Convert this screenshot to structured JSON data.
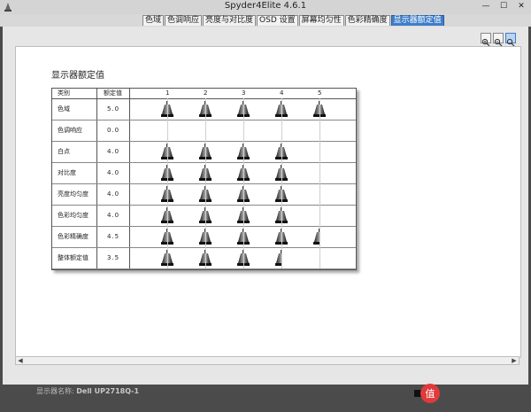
{
  "window": {
    "title": "Spyder4Elite 4.6.1"
  },
  "tabs": [
    {
      "label": "色域",
      "active": false
    },
    {
      "label": "色调响应",
      "active": false
    },
    {
      "label": "亮度与对比度",
      "active": false
    },
    {
      "label": "OSD 设置",
      "active": false
    },
    {
      "label": "屏幕均匀性",
      "active": false
    },
    {
      "label": "色彩精确度",
      "active": false
    },
    {
      "label": "显示器额定值",
      "active": true
    }
  ],
  "report": {
    "title": "显示器额定值",
    "headers": {
      "category": "类别",
      "rating": "额定值",
      "scale": [
        "1",
        "2",
        "3",
        "4",
        "5"
      ]
    },
    "rows": [
      {
        "category": "色域",
        "value": "5.0",
        "rating": 5.0
      },
      {
        "category": "色调响应",
        "value": "0.0",
        "rating": 0.0
      },
      {
        "category": "白点",
        "value": "4.0",
        "rating": 4.0
      },
      {
        "category": "对比度",
        "value": "4.0",
        "rating": 4.0
      },
      {
        "category": "亮度均匀度",
        "value": "4.0",
        "rating": 4.0
      },
      {
        "category": "色彩均匀度",
        "value": "4.0",
        "rating": 4.0
      },
      {
        "category": "色彩精确度",
        "value": "4.5",
        "rating": 4.5
      },
      {
        "category": "整体额定值",
        "value": "3.5",
        "rating": 3.5
      }
    ]
  },
  "status": {
    "label": "显示器名称:",
    "device": "Dell UP2718Q-1"
  },
  "colors": {
    "active_tab": "#3f7ec9",
    "window": "#4b4b4b"
  }
}
